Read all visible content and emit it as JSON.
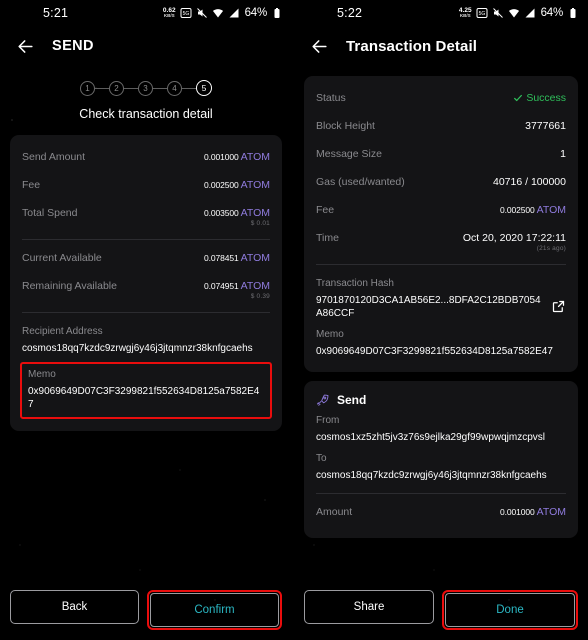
{
  "left": {
    "statusbar": {
      "time": "5:21",
      "net_speed_value": "0.62",
      "net_speed_unit": "KB/S",
      "battery": "64%",
      "icons": [
        "data-saver-icon",
        "mute-icon",
        "wifi-icon",
        "signal-icon",
        "battery-icon"
      ]
    },
    "appbar": {
      "title": "SEND",
      "back": "back-arrow-icon"
    },
    "steps": {
      "items": [
        "1",
        "2",
        "3",
        "4",
        "5"
      ],
      "active_index": 4
    },
    "caption": "Check transaction detail",
    "summary_rows": [
      {
        "label": "Send Amount",
        "amount": "0.001000",
        "unit": "ATOM",
        "usd": ""
      },
      {
        "label": "Fee",
        "amount": "0.002500",
        "unit": "ATOM",
        "usd": ""
      },
      {
        "label": "Total Spend",
        "amount": "0.003500",
        "unit": "ATOM",
        "usd": "$ 0.01"
      }
    ],
    "balance_rows": [
      {
        "label": "Current Available",
        "amount": "0.078451",
        "unit": "ATOM",
        "usd": ""
      },
      {
        "label": "Remaining Available",
        "amount": "0.074951",
        "unit": "ATOM",
        "usd": "$ 0.39"
      }
    ],
    "recipient": {
      "label": "Recipient Address",
      "value": "cosmos18qq7kzdc9zrwgj6y46j3jtqmnzr38knfgcaehs"
    },
    "memo": {
      "label": "Memo",
      "value": "0x9069649D07C3F3299821f552634D8125a7582E47"
    },
    "buttons": {
      "secondary": "Back",
      "primary": "Confirm"
    }
  },
  "right": {
    "statusbar": {
      "time": "5:22",
      "net_speed_value": "4.25",
      "net_speed_unit": "KB/S",
      "battery": "64%",
      "icons": [
        "data-saver-icon",
        "mute-icon",
        "wifi-icon",
        "signal-icon",
        "battery-icon"
      ]
    },
    "appbar": {
      "title": "Transaction Detail",
      "back": "back-arrow-icon"
    },
    "detail_rows": [
      {
        "label": "Status",
        "value": "Success",
        "type": "status"
      },
      {
        "label": "Block Height",
        "value": "3777661",
        "type": "plain"
      },
      {
        "label": "Message Size",
        "value": "1",
        "type": "plain"
      },
      {
        "label": "Gas (used/wanted)",
        "value": "40716 / 100000",
        "type": "plain"
      },
      {
        "label": "Fee",
        "amount": "0.002500",
        "unit": "ATOM",
        "type": "atom"
      },
      {
        "label": "Time",
        "value": "Oct 20, 2020 17:22:11",
        "sub": "(21s ago)",
        "type": "time"
      }
    ],
    "tx_hash": {
      "label": "Transaction Hash",
      "value": "9701870120D3CA1AB56E2...8DFA2C12BDB7054A86CCF",
      "icon": "external-link-icon"
    },
    "memo": {
      "label": "Memo",
      "value": "0x9069649D07C3F3299821f552634D8125a7582E47"
    },
    "send_card": {
      "icon": "rocket-icon",
      "title": "Send",
      "from_label": "From",
      "from_value": "cosmos1xz5zht5jv3z76s9ejlka29gf99wpwqjmzcpvsl",
      "to_label": "To",
      "to_value": "cosmos18qq7kzdc9zrwgj6y46j3jtqmnzr38knfgcaehs",
      "amount_label": "Amount",
      "amount": "0.001000",
      "unit": "ATOM"
    },
    "buttons": {
      "secondary": "Share",
      "primary": "Done"
    }
  },
  "colors": {
    "accent_atom": "#8f7bdd",
    "accent_primary_btn": "#2bb8c4",
    "highlight_box": "#ea0d0d",
    "success": "#2fbf5b",
    "card_bg": "#141416"
  }
}
